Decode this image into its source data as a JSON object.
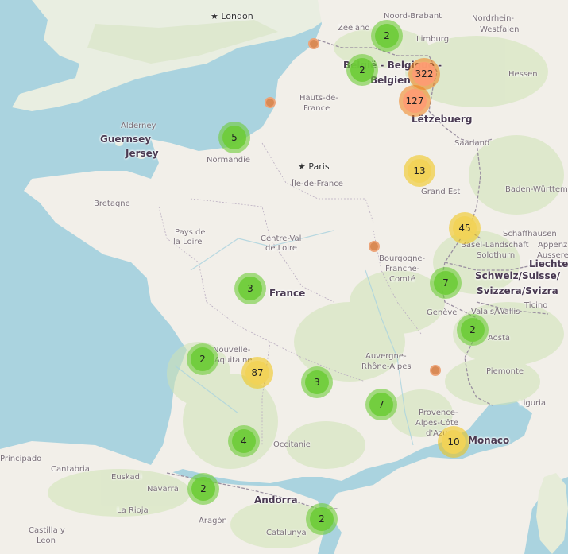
{
  "map": {
    "country_labels": [
      {
        "id": "belgique",
        "text": "België - Belgique -"
      },
      {
        "id": "belgien",
        "text": "Belgien"
      },
      {
        "id": "letzebuerg",
        "text": "Lëtzebuerg"
      },
      {
        "id": "france",
        "text": "France"
      },
      {
        "id": "schweiz",
        "text": "Schweiz/Suisse/"
      },
      {
        "id": "svizzera",
        "text": "Svizzera/Svizra"
      },
      {
        "id": "andorra",
        "text": "Andorra"
      },
      {
        "id": "monaco",
        "text": "Monaco"
      },
      {
        "id": "guernsey",
        "text": "Guernsey"
      },
      {
        "id": "jersey",
        "text": "Jersey"
      },
      {
        "id": "liechten",
        "text": "Liechten"
      }
    ],
    "city_labels": [
      {
        "id": "london",
        "text": "London"
      },
      {
        "id": "paris",
        "text": "Paris"
      }
    ],
    "region_labels": [
      {
        "id": "noord-brabant",
        "text": "Noord-Brabant"
      },
      {
        "id": "zeeland",
        "text": "Zeeland"
      },
      {
        "id": "limburg",
        "text": "Limburg"
      },
      {
        "id": "nordrhein",
        "text": "Nordrhein-"
      },
      {
        "id": "westfalen",
        "text": "Westfalen"
      },
      {
        "id": "hessen",
        "text": "Hessen"
      },
      {
        "id": "hauts",
        "text": "Hauts-de-"
      },
      {
        "id": "hauts2",
        "text": "France"
      },
      {
        "id": "alderney",
        "text": "Alderney"
      },
      {
        "id": "normandie",
        "text": "Normandie"
      },
      {
        "id": "iledefrance",
        "text": "Île-de-France"
      },
      {
        "id": "saarland",
        "text": "Saarland"
      },
      {
        "id": "grandest",
        "text": "Grand Est"
      },
      {
        "id": "bretagne",
        "text": "Bretagne"
      },
      {
        "id": "baden",
        "text": "Baden-Württem"
      },
      {
        "id": "paysdela",
        "text": "Pays de"
      },
      {
        "id": "paysdela2",
        "text": "la Loire"
      },
      {
        "id": "centreval",
        "text": "Centre-Val"
      },
      {
        "id": "centreval2",
        "text": "de Loire"
      },
      {
        "id": "bourgogne",
        "text": "Bourgogne-"
      },
      {
        "id": "bourgogne2",
        "text": "Franche-"
      },
      {
        "id": "bourgogne3",
        "text": "Comté"
      },
      {
        "id": "schaffhausen",
        "text": "Schaffhausen"
      },
      {
        "id": "basel",
        "text": "Basel-Landschaft"
      },
      {
        "id": "solothurn",
        "text": "Solothurn"
      },
      {
        "id": "appenzell",
        "text": "Appenz"
      },
      {
        "id": "aussere",
        "text": "Aussere"
      },
      {
        "id": "geneve",
        "text": "Genève"
      },
      {
        "id": "valais",
        "text": "Valais/Wallis"
      },
      {
        "id": "ticino",
        "text": "Ticino"
      },
      {
        "id": "aosta",
        "text": "Aosta"
      },
      {
        "id": "nouvelle",
        "text": "Nouvelle-"
      },
      {
        "id": "aquitaine",
        "text": "Aquitaine"
      },
      {
        "id": "auvergne",
        "text": "Auvergne-"
      },
      {
        "id": "rhonealpes",
        "text": "Rhône-Alpes"
      },
      {
        "id": "piemonte",
        "text": "Piemonte"
      },
      {
        "id": "liguria",
        "text": "Liguria"
      },
      {
        "id": "provence",
        "text": "Provence-"
      },
      {
        "id": "provence2",
        "text": "Alpes-Côte"
      },
      {
        "id": "provence3",
        "text": "d'Azur"
      },
      {
        "id": "occitanie",
        "text": "Occitanie"
      },
      {
        "id": "cantabria",
        "text": "Cantabria"
      },
      {
        "id": "euskadi",
        "text": "Euskadi"
      },
      {
        "id": "navarra",
        "text": "Navarra"
      },
      {
        "id": "asturias",
        "text": "Principado"
      },
      {
        "id": "larioja",
        "text": "La Rioja"
      },
      {
        "id": "aragon",
        "text": "Aragón"
      },
      {
        "id": "catalunya",
        "text": "Catalunya"
      },
      {
        "id": "castilla",
        "text": "Castilla y"
      },
      {
        "id": "leon",
        "text": "León"
      }
    ],
    "clusters": [
      {
        "id": "c1",
        "count": "2",
        "size": "small"
      },
      {
        "id": "c2",
        "count": "2",
        "size": "small"
      },
      {
        "id": "c3",
        "count": "322",
        "size": "large"
      },
      {
        "id": "c4",
        "count": "127",
        "size": "large"
      },
      {
        "id": "c5",
        "count": "5",
        "size": "small"
      },
      {
        "id": "c6",
        "count": "13",
        "size": "medium"
      },
      {
        "id": "c7",
        "count": "45",
        "size": "medium"
      },
      {
        "id": "c8",
        "count": "7",
        "size": "small"
      },
      {
        "id": "c9",
        "count": "3",
        "size": "small"
      },
      {
        "id": "c10",
        "count": "2",
        "size": "small"
      },
      {
        "id": "c11",
        "count": "2",
        "size": "small"
      },
      {
        "id": "c12",
        "count": "87",
        "size": "medium"
      },
      {
        "id": "c13",
        "count": "3",
        "size": "small"
      },
      {
        "id": "c14",
        "count": "7",
        "size": "small"
      },
      {
        "id": "c15",
        "count": "4",
        "size": "small"
      },
      {
        "id": "c16",
        "count": "10",
        "size": "medium"
      },
      {
        "id": "c17",
        "count": "2",
        "size": "small"
      },
      {
        "id": "c18",
        "count": "2",
        "size": "small"
      }
    ],
    "colors": {
      "sea": "#aad3df",
      "land": "#f2efe9",
      "forest": "#cfe3b5",
      "cluster_small": "#6ecc39",
      "cluster_medium": "#f1d357",
      "cluster_large": "#fd9c73",
      "single_marker": "#d98a55"
    }
  }
}
